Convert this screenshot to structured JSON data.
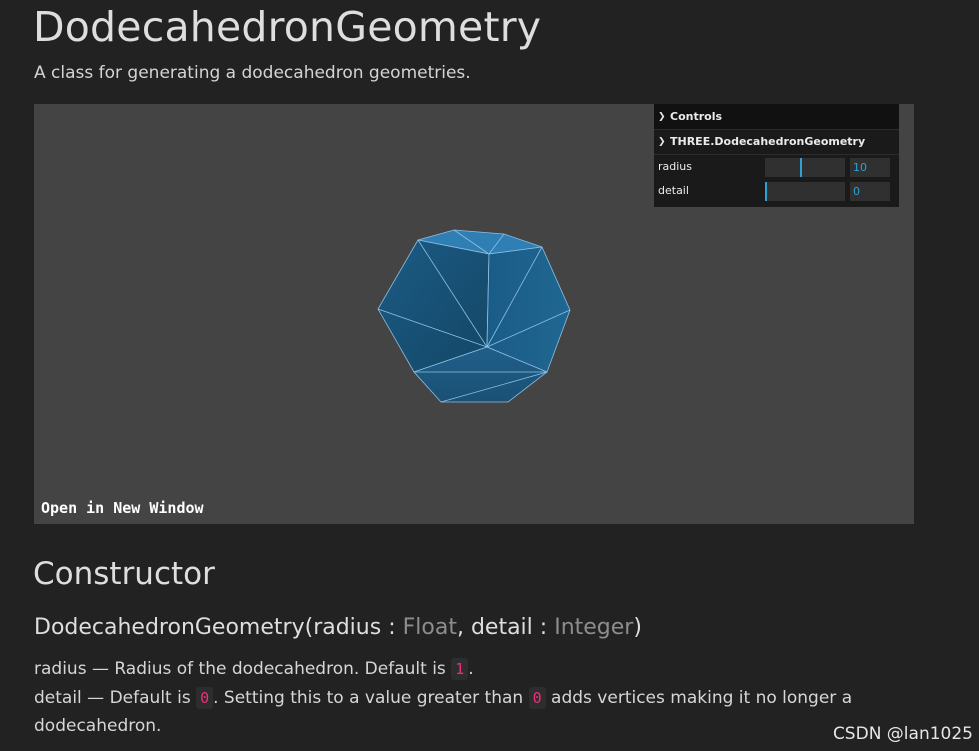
{
  "page": {
    "title": "DodecahedronGeometry",
    "subtitle": "A class for generating a dodecahedron geometries."
  },
  "viewport": {
    "open_link": "Open in New Window",
    "background": "#444444",
    "mesh_color": "#1e5f8a"
  },
  "gui": {
    "title": "Controls",
    "folder": "THREE.DodecahedronGeometry",
    "accent": "#2fa1d6",
    "controls": [
      {
        "label": "radius",
        "value": "10",
        "fraction": 0.45
      },
      {
        "label": "detail",
        "value": "0",
        "fraction": 0.0
      }
    ]
  },
  "constructor": {
    "heading": "Constructor",
    "name": "DodecahedronGeometry",
    "open_paren": "(",
    "param1": "radius",
    "sep1": " : ",
    "type1": "Float",
    "comma": ", ",
    "param2": "detail",
    "sep2": " : ",
    "type2": "Integer",
    "close_paren": ")"
  },
  "params": {
    "radius_text": "radius — Radius of the dodecahedron. Default is",
    "radius_default": "1",
    "radius_end": ".",
    "detail_text": "detail — Default is",
    "detail_default": "0",
    "detail_mid": ". Setting this to a value greater than",
    "detail_value": "0",
    "detail_end": "adds vertices making it no longer a",
    "detail_end2": "dodecahedron."
  },
  "watermark": "CSDN @lan1025"
}
